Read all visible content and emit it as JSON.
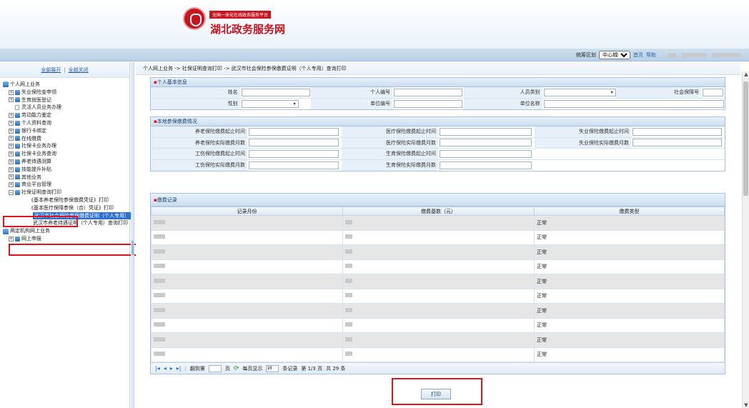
{
  "header": {
    "platform_tag": "全国一体化在线政务服务平台",
    "site_title": "湖北政务服务网"
  },
  "topbar": {
    "region_label": "统筹区划",
    "region_value": "中心城区",
    "home_link": "首页",
    "help_link": "帮助"
  },
  "sidebar": {
    "expand_all": "全部展开",
    "sep": "|",
    "collapse_all": "全部关闭",
    "root1": "个人网上业务",
    "items": [
      {
        "label": "失业保险金申领"
      },
      {
        "label": "生育就医登记"
      },
      {
        "label": "灵活人员业务办理"
      },
      {
        "label": "劳动能力鉴定"
      },
      {
        "label": "个人资料查询"
      },
      {
        "label": "银行卡绑定"
      },
      {
        "label": "在线缴费"
      },
      {
        "label": "社保卡业务办理"
      },
      {
        "label": "社保卡业务查询"
      },
      {
        "label": "养老待遇测算"
      },
      {
        "label": "技能提升补贴"
      },
      {
        "label": "其他业务"
      },
      {
        "label": "商业平台管理"
      }
    ],
    "print_node": "社保证明查询打印",
    "print_children": [
      {
        "label": "《基本养老保险参保缴费凭证》打印"
      },
      {
        "label": "《基本医疗保障参保（合）凭证》打印"
      },
      {
        "label": "武汉市社会保险参保缴费证明（个人专用）"
      },
      {
        "label": "武汉市养老待遇证明（个人专用）查询打印"
      }
    ],
    "root2": "两定机构网上业务",
    "root2_child": "网上申报"
  },
  "breadcrumb": "个人网上业务 -> 社保证明查询打印 -> 武汉市社会保险参保缴费证明（个人专用）查询打印",
  "basic_info": {
    "title": "个人基本信息",
    "name": "姓名",
    "person_no": "个人编号",
    "person_type": "人员类别",
    "ss_no": "社会保障号",
    "gender": "性别",
    "unit_no": "单位编号",
    "unit_name": "单位名称"
  },
  "local_info": {
    "title": "本地参保缴费情况",
    "pension_start": "养老保险缴费起止时间",
    "medical_start": "医疗保险缴费起止时间",
    "unemp_start": "失业保险缴费起止时间",
    "pension_months": "养老保险实际缴费月数",
    "medical_months": "医疗保险实际缴费月数",
    "unemp_months": "失业保险实际缴费月数",
    "injury_start": "工伤保险缴费起止时间",
    "maternity_start": "生育保险缴费起止时间",
    "injury_months": "工伤保险实际缴费月数",
    "maternity_months": "生育保险实际缴费月数"
  },
  "records": {
    "title": "缴费记录",
    "col_month": "记录月份",
    "col_base": "缴费基数（元）",
    "col_type": "缴费类型",
    "status": [
      "正常",
      "正常",
      "正常",
      "正常",
      "正常",
      "正常",
      "正常",
      "正常",
      "正常",
      "正常"
    ]
  },
  "pager": {
    "goto": "翻到第",
    "page_unit": "页",
    "per_page": "每页显示",
    "per_page_value": "10",
    "records_unit": "条记录",
    "page_info": "第 1/3 页",
    "total": "共 29 条"
  },
  "print_button": "打印",
  "icons": {
    "logo": "red-seal-logo-icon",
    "first": "first-page-icon",
    "prev": "prev-page-icon",
    "next": "next-page-icon",
    "last": "last-page-icon",
    "refresh": "refresh-icon"
  },
  "colors": {
    "brand_red": "#c8141e",
    "highlight_red": "#e0141e",
    "selected_blue": "#2a6fd6",
    "panel_border": "#a9c3dc"
  }
}
